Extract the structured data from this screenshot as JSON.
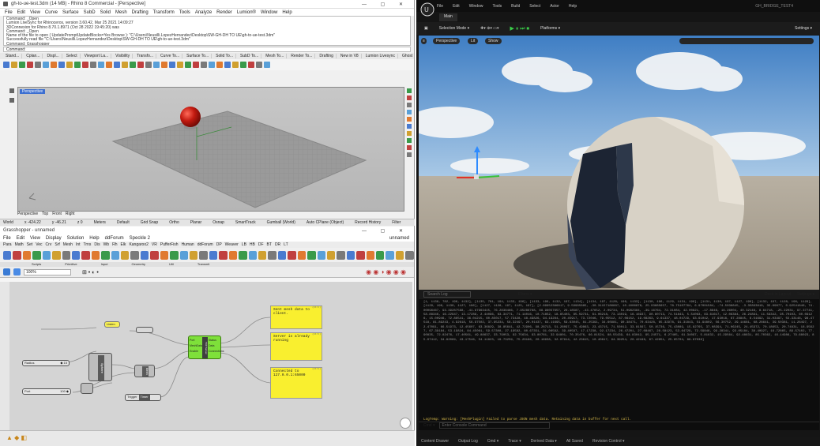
{
  "rhino": {
    "title": "gh-to-ue-test.3dm (14 MB) - Rhino 8 Commercial - [Perspective]",
    "menu": [
      "File",
      "Edit",
      "View",
      "Curve",
      "Surface",
      "SubD",
      "Solid",
      "Mesh",
      "Drafting",
      "Transform",
      "Tools",
      "Analyze",
      "Render",
      "Lumion®",
      "Window",
      "Help"
    ],
    "command_history": [
      "Command: _Open",
      "Lumion LiveSync for Rhinoceros, version 3.60.42, Mar 25 2021 14:09:27",
      "3DConnexion for Rhino 8.70.1.8971 (Oct 28 2022 19:45:20) was",
      "Command: _Open",
      "Name of the file to open ( UpdatePromptUpdateBlocks=Yes  Browse ): \"C:\\Users\\Neusilli.LopezHernandez\\Desktop\\SW-GH-DH TO UE\\gh-to-ue-test.3dm\"",
      "Successfully read file \"C:\\Users\\Neusilli.LopezHernandez\\Desktop\\SW-GH-DH TO UE\\gh-to-ue-test.3dm\"",
      "Command: Grasshopper"
    ],
    "command_prompt": "Command:",
    "tabs": [
      "Stand...",
      "Cplan...",
      "Displ...",
      "Select",
      "Viewport La...",
      "Visibility",
      "Transfo...",
      "Curve To...",
      "Surface To...",
      "Solid To...",
      "SubD To...",
      "Mesh To...",
      "Render To...",
      "Drafting",
      "New in V8",
      "Lumion Livesync",
      "Ghost Gam...",
      "Ghosts Plu...",
      "Datasmith"
    ],
    "viewport_label": "Perspective",
    "view_tabs": [
      "Perspective",
      "Top",
      "Front",
      "Right"
    ],
    "status": [
      "World",
      "x -424.22",
      "y -46.21",
      "z 0",
      "Meters",
      "Default",
      "Grid Snap",
      "Ortho",
      "Planar",
      "Osnap",
      "SmartTrack",
      "Gumball (World)",
      "Auto CPlane (Object)",
      "Record History",
      "Filter"
    ]
  },
  "gh": {
    "title": "Grasshopper - unnamed",
    "menu": [
      "File",
      "Edit",
      "View",
      "Display",
      "Solution",
      "Help",
      "ddForum",
      "Speckle 2"
    ],
    "unnamed": "unnamed",
    "tabs": [
      "Para",
      "Math",
      "Set",
      "Vec",
      "Crv",
      "Srf",
      "Mesh",
      "Int",
      "Trns",
      "Dis",
      "Wb",
      "Rh",
      "Elk",
      "Kangaroo2",
      "VR",
      "PufferFish",
      "Human",
      "ddForum",
      "DP",
      "Weaver",
      "LB",
      "HB",
      "DF",
      "BT",
      "DR",
      "LT"
    ],
    "categories": [
      "Scripts",
      "Primitive",
      "Input",
      "Geometry",
      "Util",
      "Transmit"
    ],
    "zoom": "100%",
    "panels": [
      {
        "id": "p1",
        "title": "(Ctrl)",
        "text": "Sent mesh data to client."
      },
      {
        "id": "p2",
        "title": "(Ctrl)",
        "text": "Server is already running"
      },
      {
        "id": "p3",
        "title": "(Ctrl)",
        "text": "Connected to 127.0.0.1:65000"
      }
    ],
    "nodes": {
      "toggle": "Listen",
      "slider1": "Radius",
      "slider1_val": "◆ 15",
      "slider2": "Port",
      "slider2_val": "100 ◆",
      "sphere": "Sphere",
      "mesh": "Mesh",
      "server": "TCP Server",
      "server_inputs": [
        "Port",
        "MeshData",
        "Enable"
      ],
      "server_outputs": [
        "Status",
        "Data",
        "Connections"
      ],
      "trigger": "Trigger",
      "timer": "Timer"
    }
  },
  "ue": {
    "menu": [
      "File",
      "Edit",
      "Window",
      "Tools",
      "Build",
      "Select",
      "Actor",
      "Help"
    ],
    "project": "GH_BRIDGE_TEST4",
    "map_tab": "Main",
    "toolbar": [
      "Selection Mode ▾",
      "Platforms ▾",
      "Settings ▾"
    ],
    "viewport_buttons": [
      "Perspective",
      "Lit",
      "Show"
    ],
    "log_search_placeholder": "Search Log",
    "log_filters": "Filters ▾",
    "log_right": [
      "Dock in Layout",
      "Settings ▾"
    ],
    "log_lines": "[1, 1138, 782, 196, 1132], [1135, 781, 194, 1133, 196], [1133, 196, 1132, 197, 1134], [1134, 197, 1128, 196, 1133], [1130, 196, 1129, 1131, 196], [1131, 1130, 197, 1127, 196], [1132, 197, 1128, 196, 1129], [1129, 196, 1130, 1127, 196], [1127, 1128, 197, 1125, 197], [2.89952386817, 9.59985685, -30.31157186887, 10.1006878, 25.03885657, 78.75107764, 6.97001584, -74.5038845, -3.35893818, 35.69877, 0.92541846, 74.00096467, 93.39287568, -41.97963445, 76.2838486, 7.95286768, 88.96057657, 26.18587, -43.47652, 2.09734, 51.0962384, -39.16764, 72.31084, 42.00821, -17.8846, 16.26004, 40.32148, 8.64718, -25.22031, 97.37741, 58.88346, 16.22947, 13.17289, 2.44096, 63.34771, 71.14016, 10.71852, 18.65403, 85.59731, 61.06218, 73.13019, 16.16937, 90.80713, 74.51843, 5.54063, 83.61617, 12.06384, 26.24891, 11.59342, 95.70103, 60.09126, 15.00946, 72.86541, 36.04215, 60.85017, 57.73428, 48.49826, 94.19284, 20.45917, 73.72046, 79.05512, 87.06152, 19.08263, 9.61337, 48.04729, 93.61042, 17.93018, 67.28845, 6.51692, 31.03497, 55.33146, 96.47518, 81.89243, 4.92618, 56.97502, 37.95234, 58.32497, 20.01437, 63.11695, 59.63045, 81.25391, 34.60981, 90.38471, 70.63428, 65.32978, 91.31843, 51.94802, 56.30752, 29.14681, 68.28641, 39.50381, 11.28497, 22.47091, 66.51973, 12.45607, 63.36829, 38.85641, 42.72906, 98.28713, 51.26097, 75.49863, 23.43715, 71.56012, 33.81567, 50.15736, 75.43089, 15.82765, 37.08394, 71.06245, 24.45972, 70.18653, 20.74831, 18.95627, 67.39184, 53.19824, 84.45061, 59.57308, 27.19582, 80.67351, 91.06582, 39.40587, 17.17238, 92.17234, 26.47201, 27.08467, 28.58123, 53.64729, 72.59846, 99.28341, 93.05184, 38.40927, 16.72865, 89.57102, 77.90835, 72.82476, 17.40561, 49.88637, 33.79053, 92.75634, 93.80761, 32.94801, 70.35476, 66.81524, 88.55439, 64.83042, 95.24571, 6.27465, 61.34097, 5.81632, 15.29564, 92.48631, 85.70362, 16.14986, 79.68023, 85.07412, 34.82069, 43.17546, 54.11823, 19.73259, 75.20186, 20.16938, 32.07914, 42.23615, 10.40817, 94.39254, 20.42196, 67.42851, 25.65704, 89.87036]",
    "log_warning": "LogTemp: Warning: [MeshPlugin] Failed to parse JSON mesh data. Retaining data in buffer for next call.",
    "cmd_label": "Cmd ▾",
    "cmd_placeholder": "Enter Console Command",
    "bottom": [
      "Content Drawer",
      "Output Log",
      "Cmd ▾",
      "Trace ▾",
      "Derived Data ▾",
      "All Saved",
      "Revision Control ▾"
    ]
  }
}
